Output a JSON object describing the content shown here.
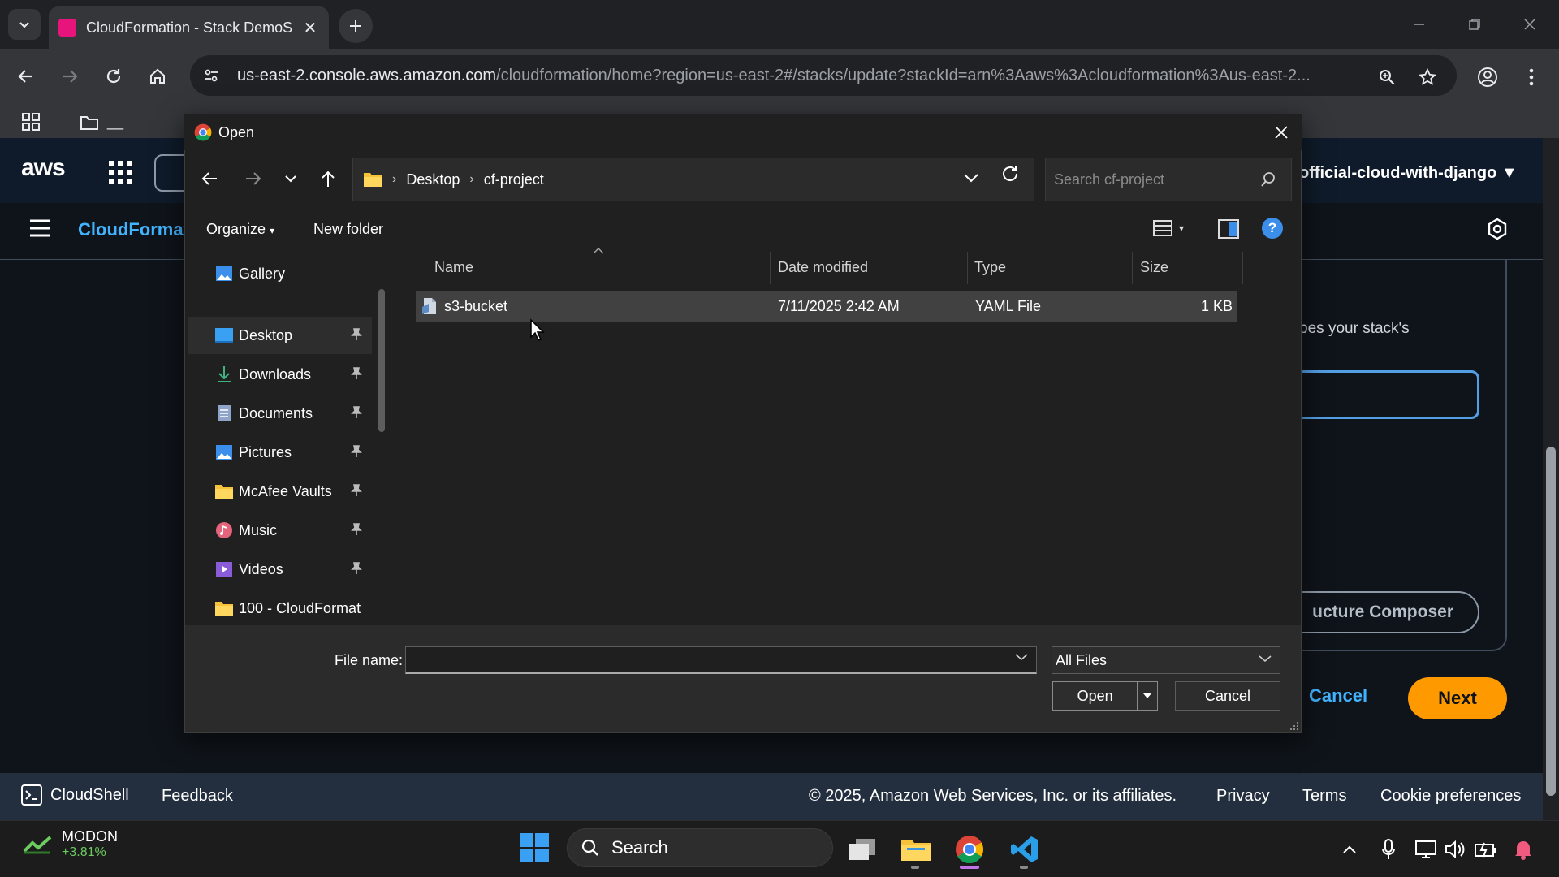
{
  "browser": {
    "tab": {
      "title": "CloudFormation - Stack DemoS"
    },
    "url_host": "us-east-2.console.aws.amazon.com",
    "url_path": "/cloudformation/home?region=us-east-2#/stacks/update?stackId=arn%3Aaws%3Acloudformation%3Aus-east-2...",
    "bookmark_label": "__"
  },
  "aws": {
    "logo": "aws",
    "account": "official-cloud-with-django ▼",
    "service": "CloudFormat",
    "description_fragment": "cribes your stack's",
    "composer_button": "ucture Composer",
    "cancel": "Cancel",
    "next": "Next",
    "footer": {
      "cloudshell": "CloudShell",
      "feedback": "Feedback",
      "copyright": "© 2025, Amazon Web Services, Inc. or its affiliates.",
      "privacy": "Privacy",
      "terms": "Terms",
      "cookies": "Cookie preferences"
    }
  },
  "dialog": {
    "title": "Open",
    "breadcrumb": [
      "Desktop",
      "cf-project"
    ],
    "search_placeholder": "Search cf-project",
    "organize": "Organize",
    "new_folder": "New folder",
    "help": "?",
    "nav_items": [
      {
        "label": "Gallery",
        "icon": "gallery-icon"
      },
      {
        "label": "Desktop",
        "icon": "desktop-icon",
        "pinned": true
      },
      {
        "label": "Downloads",
        "icon": "downloads-icon",
        "pinned": true
      },
      {
        "label": "Documents",
        "icon": "documents-icon",
        "pinned": true
      },
      {
        "label": "Pictures",
        "icon": "pictures-icon",
        "pinned": true
      },
      {
        "label": "McAfee Vaults",
        "icon": "folder-icon",
        "pinned": true
      },
      {
        "label": "Music",
        "icon": "music-icon",
        "pinned": true
      },
      {
        "label": "Videos",
        "icon": "videos-icon",
        "pinned": true
      },
      {
        "label": "100 - CloudFormat",
        "icon": "folder-icon"
      }
    ],
    "columns": {
      "name": "Name",
      "date": "Date modified",
      "type": "Type",
      "size": "Size"
    },
    "files": [
      {
        "name": "s3-bucket",
        "date": "7/11/2025 2:42 AM",
        "type": "YAML File",
        "size": "1 KB"
      }
    ],
    "file_name_label": "File name:",
    "file_name_value": "",
    "file_type": "All Files",
    "open": "Open",
    "cancel": "Cancel"
  },
  "taskbar": {
    "ticker_name": "MODON",
    "ticker_change": "+3.81%",
    "search": "Search"
  },
  "colors": {
    "aws_orange": "#ff9900",
    "aws_link": "#42b4ff",
    "chrome_dark": "#202124",
    "dialog_bg": "#202020",
    "selected_row": "#414141"
  }
}
